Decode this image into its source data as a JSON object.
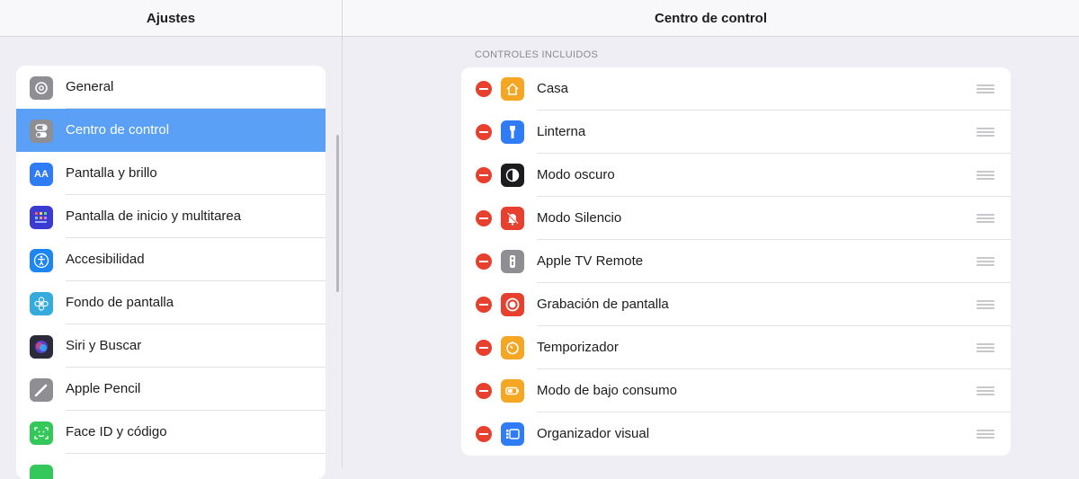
{
  "header": {
    "left_title": "Ajustes",
    "right_title": "Centro de control"
  },
  "sidebar": {
    "items": [
      {
        "label": "General",
        "icon": "gear-icon",
        "color": "#8e8e93"
      },
      {
        "label": "Centro de control",
        "icon": "toggles-icon",
        "color": "#8e8e93",
        "selected": true
      },
      {
        "label": "Pantalla y brillo",
        "icon": "text-size-icon",
        "color": "#2f7cf6"
      },
      {
        "label": "Pantalla de inicio y multitarea",
        "icon": "home-grid-icon",
        "color": "#3b3bd1"
      },
      {
        "label": "Accesibilidad",
        "icon": "accessibility-icon",
        "color": "#1e86f0"
      },
      {
        "label": "Fondo de pantalla",
        "icon": "flower-icon",
        "color": "#35aadc"
      },
      {
        "label": "Siri y Buscar",
        "icon": "siri-icon",
        "color": "#2b2b3a"
      },
      {
        "label": "Apple Pencil",
        "icon": "pencil-icon",
        "color": "#8e8e93"
      },
      {
        "label": "Face ID y código",
        "icon": "face-id-icon",
        "color": "#34c759"
      }
    ]
  },
  "content": {
    "section_label": "CONTROLES INCLUIDOS",
    "controls": [
      {
        "label": "Casa",
        "icon": "home-icon",
        "color": "#f5a623"
      },
      {
        "label": "Linterna",
        "icon": "flashlight-icon",
        "color": "#2f7cf6"
      },
      {
        "label": "Modo oscuro",
        "icon": "dark-mode-icon",
        "color": "#1c1c1e"
      },
      {
        "label": "Modo Silencio",
        "icon": "bell-slash-icon",
        "color": "#e8402f"
      },
      {
        "label": "Apple TV Remote",
        "icon": "remote-icon",
        "color": "#8e8e93"
      },
      {
        "label": "Grabación de pantalla",
        "icon": "record-icon",
        "color": "#e8402f"
      },
      {
        "label": "Temporizador",
        "icon": "timer-icon",
        "color": "#f5a623"
      },
      {
        "label": "Modo de bajo consumo",
        "icon": "battery-icon",
        "color": "#f5a623"
      },
      {
        "label": "Organizador visual",
        "icon": "stage-manager-icon",
        "color": "#2f7cf6"
      }
    ]
  }
}
